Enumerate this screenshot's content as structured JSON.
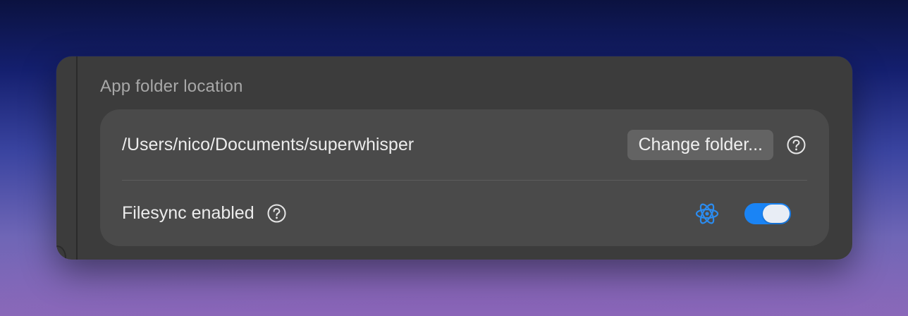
{
  "section": {
    "title": "App folder location"
  },
  "folder_row": {
    "path": "/Users/nico/Documents/superwhisper",
    "change_button_label": "Change folder..."
  },
  "filesync_row": {
    "label": "Filesync enabled",
    "toggle_on": true
  },
  "icons": {
    "help": "question-circle-icon",
    "sync": "atom-icon"
  },
  "colors": {
    "accent": "#1a84f5",
    "atom": "#2b8cf0"
  }
}
